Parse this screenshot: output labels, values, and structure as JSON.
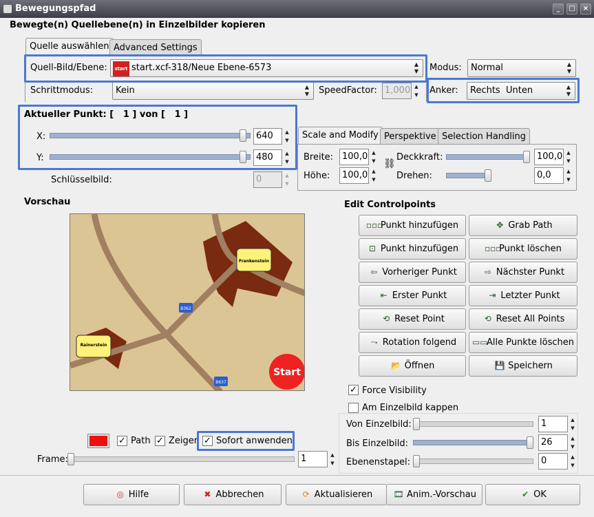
{
  "window": {
    "title": "Bewegungspfad"
  },
  "header": {
    "title": "Bewegte(n) Quellebene(n) in Einzelbilder kopieren"
  },
  "tabs_top": [
    "Quelle auswählen",
    "Advanced Settings"
  ],
  "source": {
    "label": "Quell-Bild/Ebene:",
    "value": "start.xcf-318/Neue Ebene-6573",
    "icon_text": "start"
  },
  "modus": {
    "label": "Modus:",
    "value": "Normal"
  },
  "schrittmodus": {
    "label": "Schrittmodus:",
    "value": "Kein"
  },
  "speed": {
    "label": "SpeedFactor:",
    "value": "1,000"
  },
  "anker": {
    "label": "Anker:",
    "value": "Rechts  Unten"
  },
  "current_point": {
    "label": "Aktueller Punkt: [",
    "current": "1",
    "of": "] von [",
    "total": "1",
    "close": "]"
  },
  "x": {
    "label": "X:",
    "value": "640",
    "level": 0.98
  },
  "y": {
    "label": "Y:",
    "value": "480",
    "level": 0.98
  },
  "keyframe": {
    "label": "Schlüsselbild:",
    "value": "0"
  },
  "tabs_mid": [
    "Scale and Modify",
    "Perspektive",
    "Selection Handling"
  ],
  "scale": {
    "breite_label": "Breite:",
    "breite": "100,0",
    "hoehe_label": "Höhe:",
    "hoehe": "100,0",
    "deck_label": "Deckkraft:",
    "deck": "100,0",
    "deck_level": 1.0,
    "dreh_label": "Drehen:",
    "dreh": "0,0",
    "dreh_level": 0.5
  },
  "preview": {
    "label": "Vorschau",
    "town1": "Frankenstein",
    "town2": "Rainerstein",
    "road1": "B362",
    "road2": "B637",
    "start": "Start"
  },
  "controls": {
    "title": "Edit Controlpoints",
    "buttons": [
      [
        "Punkt hinzufügen",
        "Grab Path"
      ],
      [
        "Punkt hinzufügen",
        "Punkt löschen"
      ],
      [
        "Vorheriger Punkt",
        "Nächster Punkt"
      ],
      [
        "Erster Punkt",
        "Letzter Punkt"
      ],
      [
        "Reset Point",
        "Reset All Points"
      ],
      [
        "Rotation folgend",
        "Alle Punkte löschen"
      ],
      [
        "Öffnen",
        "Speichern"
      ]
    ]
  },
  "options": {
    "force": "Force Visibility",
    "clip": "Am Einzelbild kappen"
  },
  "range": {
    "von_label": "Von Einzelbild:",
    "von": "1",
    "von_level": 0.0,
    "bis_label": "Bis Einzelbild:",
    "bis": "26",
    "bis_level": 1.0,
    "stapel_label": "Ebenenstapel:",
    "stapel": "0",
    "stapel_level": 0.0
  },
  "bottom_opts": {
    "path": "Path",
    "zeiger": "Zeiger",
    "sofort": "Sofort anwenden",
    "color": "#ee1111"
  },
  "frame": {
    "label": "Frame:",
    "value": "1",
    "level": 0.0
  },
  "footer": {
    "hilfe": "Hilfe",
    "abbrechen": "Abbrechen",
    "aktualisieren": "Aktualisieren",
    "vorschau": "Anim.-Vorschau",
    "ok": "OK"
  }
}
